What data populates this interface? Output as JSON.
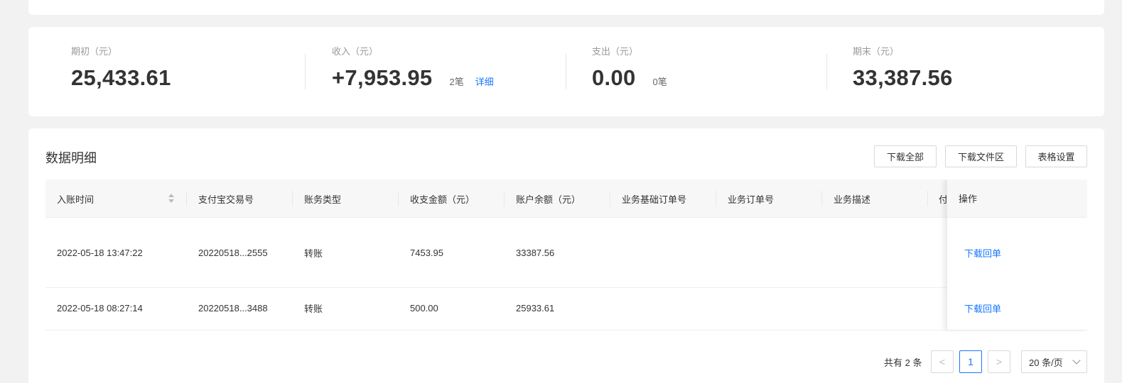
{
  "summary": {
    "opening": {
      "label": "期初（元）",
      "value": "25,433.61"
    },
    "income": {
      "label": "收入（元）",
      "value": "+7,953.95",
      "count": "2笔",
      "link": "详细"
    },
    "expense": {
      "label": "支出（元）",
      "value": "0.00",
      "count": "0笔"
    },
    "closing": {
      "label": "期末（元）",
      "value": "33,387.56"
    }
  },
  "detail": {
    "title": "数据明细",
    "buttons": {
      "download_all": "下载全部",
      "download_area": "下载文件区",
      "table_settings": "表格设置"
    },
    "columns": [
      "入账时间",
      "支付宝交易号",
      "账务类型",
      "收支金额（元）",
      "账户余额（元）",
      "业务基础订单号",
      "业务订单号",
      "业务描述",
      "付"
    ],
    "action_column": "操作",
    "rows": [
      {
        "time": "2022-05-18 13:47:22",
        "trade_no": "20220518...2555",
        "type": "转账",
        "amount": "7453.95",
        "balance": "33387.56",
        "action": "下载回单"
      },
      {
        "time": "2022-05-18 08:27:14",
        "trade_no": "20220518...3488",
        "type": "转账",
        "amount": "500.00",
        "balance": "25933.61",
        "action": "下载回单"
      }
    ]
  },
  "pagination": {
    "total": "共有 2 条",
    "current_page": "1",
    "prev": "<",
    "next": ">",
    "page_size": "20 条/页"
  },
  "colors": {
    "accent": "#1677ff",
    "background": "#f2f2f2"
  }
}
